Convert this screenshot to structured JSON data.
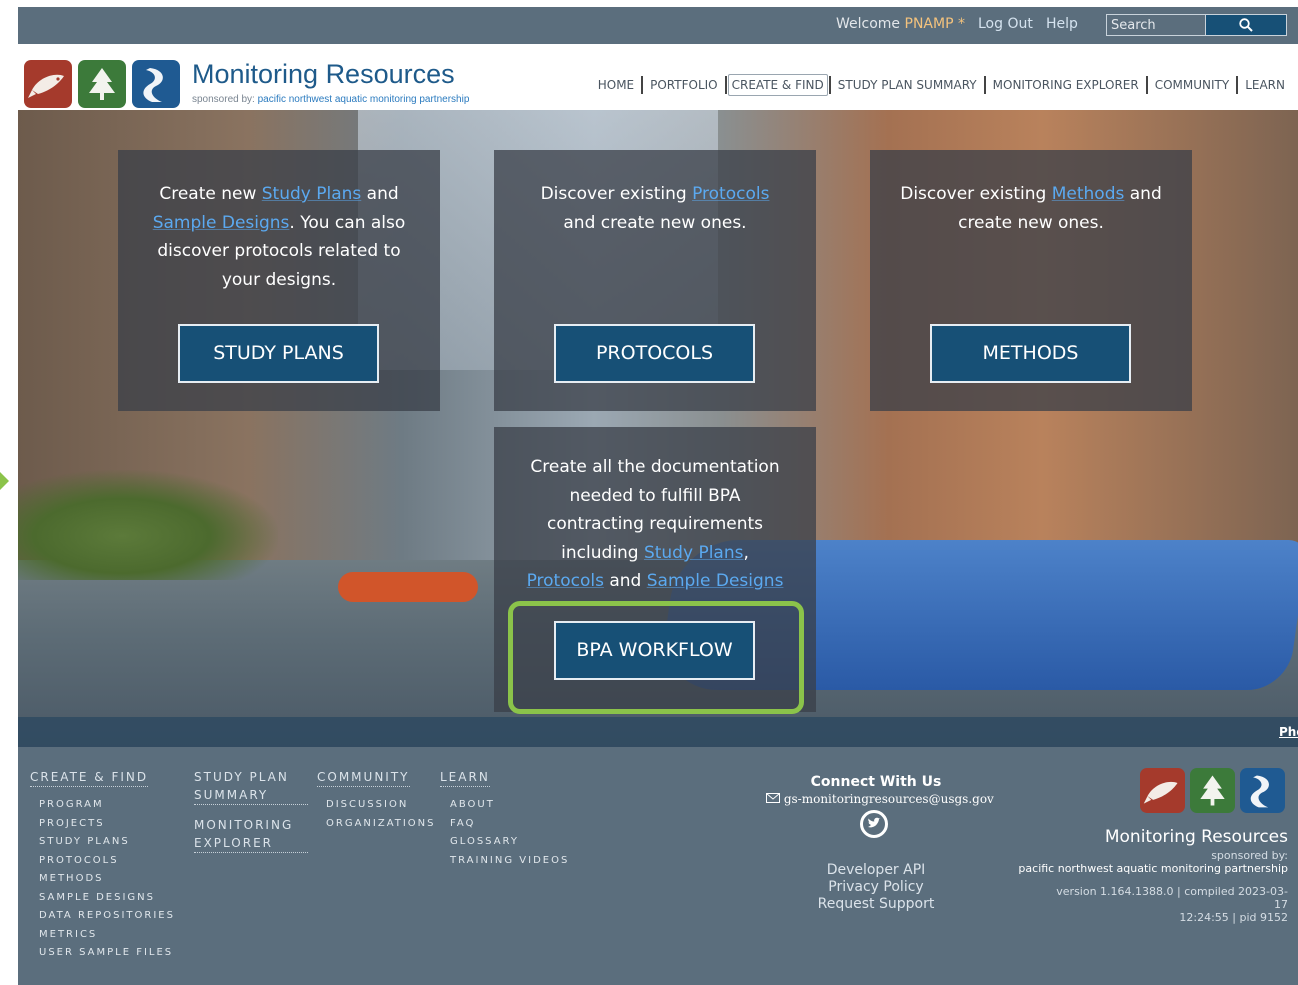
{
  "topbar": {
    "welcome": "Welcome",
    "user": "PNAMP *",
    "logout": "Log Out",
    "help": "Help",
    "search_placeholder": "Search"
  },
  "brand": {
    "title": "Monitoring Resources",
    "sponsored_prefix": "sponsored by: ",
    "org": "pacific northwest aquatic monitoring partnership",
    "logo_colors": [
      "#a53a2c",
      "#3c7a3a",
      "#1f5a92"
    ]
  },
  "nav": {
    "items": [
      {
        "label": "HOME"
      },
      {
        "label": "PORTFOLIO"
      },
      {
        "label": "CREATE & FIND",
        "active": true
      },
      {
        "label": "STUDY PLAN SUMMARY"
      },
      {
        "label": "MONITORING EXPLORER"
      },
      {
        "label": "COMMUNITY"
      },
      {
        "label": "LEARN"
      }
    ]
  },
  "cards": {
    "study_plans": {
      "t1": "Create new ",
      "l1": "Study Plans",
      "t2": " and",
      "l2": "Sample Designs",
      "t3": ". You can also discover protocols related to your designs.",
      "button": "STUDY PLANS"
    },
    "protocols": {
      "t1": "Discover existing ",
      "l1": "Protocols",
      "t2": " and create new ones.",
      "button": "PROTOCOLS"
    },
    "methods": {
      "t1": "Discover existing ",
      "l1": "Methods",
      "t2": " and create new ones.",
      "button": "METHODS"
    },
    "bpa": {
      "t1": "Create all the documentation needed to fulfill BPA contracting requirements including ",
      "l1": "Study Plans",
      "t2": ", ",
      "l2": "Protocols",
      "t3": " and ",
      "l3": "Sample Designs",
      "button": "BPA WORKFLOW"
    }
  },
  "hero": {
    "photo_credit": "Pho"
  },
  "footer": {
    "create_find": {
      "heading": "CREATE & FIND",
      "links": [
        "PROGRAM",
        "PROJECTS",
        "STUDY PLANS",
        "PROTOCOLS",
        "METHODS",
        "SAMPLE DESIGNS",
        "DATA REPOSITORIES",
        "METRICS",
        "USER SAMPLE FILES"
      ]
    },
    "study_plan_summary": {
      "line1": "STUDY PLAN",
      "line2": "SUMMARY"
    },
    "monitoring_explorer": {
      "line1": "MONITORING",
      "line2": "EXPLORER"
    },
    "community": {
      "heading": "COMMUNITY",
      "links": [
        "DISCUSSION",
        "ORGANIZATIONS"
      ]
    },
    "learn": {
      "heading": "LEARN",
      "links": [
        "ABOUT",
        "FAQ",
        "GLOSSARY",
        "TRAINING VIDEOS"
      ]
    },
    "connect": {
      "heading": "Connect With Us",
      "email": "gs-monitoringresources@usgs.gov"
    },
    "links": [
      "Developer API",
      "Privacy Policy",
      "Request Support"
    ],
    "brand": {
      "title": "Monitoring Resources",
      "sponsored": "sponsored by:",
      "org": "pacific northwest aquatic monitoring partnership",
      "version_line1": "version 1.164.1388.0 | compiled 2023-03-17",
      "version_line2": "12:24:55 | pid 9152"
    }
  },
  "colors": {
    "topbar_bg": "#5b6e7d",
    "brand_blue": "#1e5a8a",
    "button_bg": "#175076",
    "link_blue": "#5ba9f0",
    "highlight_green": "#8bc34a",
    "footer_bg": "#5b6e7d"
  }
}
